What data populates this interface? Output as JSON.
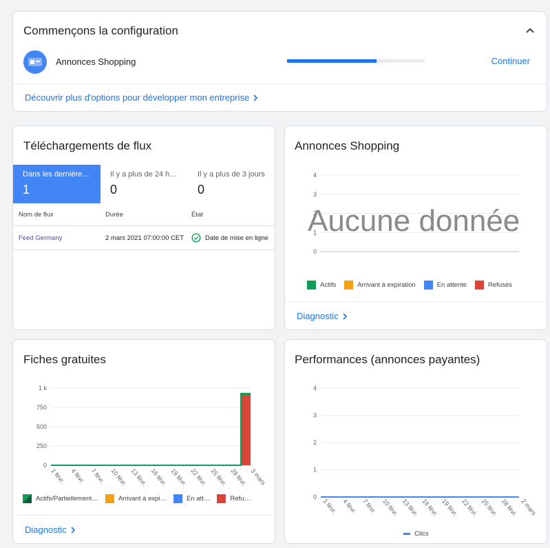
{
  "setup": {
    "title": "Commençons la configuration",
    "item_label": "Annonces Shopping",
    "progress": 0.65,
    "continue_label": "Continuer",
    "discover_label": "Découvrir plus d'options pour développer mon entreprise"
  },
  "feeds": {
    "title": "Téléchargements de flux",
    "tabs": [
      {
        "label": "Dans les dernières …",
        "value": "1"
      },
      {
        "label": "Il y a plus de 24 he…",
        "value": "0"
      },
      {
        "label": "Il y a plus de 3 jours",
        "value": "0"
      }
    ],
    "columns": [
      "Nom de flux",
      "Durée",
      "État"
    ],
    "rows": [
      {
        "name": "Feed Germany",
        "duration": "2 mars 2021 07:00:00 CET",
        "status": "Date de mise en ligne"
      }
    ]
  },
  "shopping": {
    "title": "Annonces Shopping",
    "no_data": "Aucune donnée",
    "diagnostic": "Diagnostic",
    "legend": [
      {
        "label": "Actifs",
        "color": "#0f9d58"
      },
      {
        "label": "Arrivant à expiration",
        "color": "#f4a010"
      },
      {
        "label": "En attente",
        "color": "#4285f4"
      },
      {
        "label": "Refusés",
        "color": "#db4437"
      }
    ]
  },
  "free": {
    "title": "Fiches gratuites",
    "diagnostic": "Diagnostic",
    "legend": [
      {
        "label": "Actifs/Partiellement…",
        "color": "#0f9d58"
      },
      {
        "label": "Arrivant à expi…",
        "color": "#f4a010"
      },
      {
        "label": "En att…",
        "color": "#4285f4"
      },
      {
        "label": "Refu…",
        "color": "#db4437"
      }
    ]
  },
  "perf": {
    "title": "Performances (annonces payantes)",
    "legend": [
      {
        "label": "Clics",
        "color": "#4285f4"
      }
    ]
  },
  "chart_data": [
    {
      "type": "bar",
      "title": "Annonces Shopping",
      "y_ticks": [
        "0",
        "1",
        "2",
        "3",
        "4"
      ],
      "ylim": [
        0,
        4
      ],
      "series": [],
      "annotation": "Aucune donnée",
      "grid": true,
      "legend_position": "bottom"
    },
    {
      "type": "area",
      "title": "Fiches gratuites",
      "x": [
        "1 févr.",
        "4 févr.",
        "7 févr.",
        "10 févr.",
        "13 févr.",
        "16 févr.",
        "19 févr.",
        "22 févr.",
        "25 févr.",
        "28 févr.",
        "3 mars"
      ],
      "y_ticks": [
        "0",
        "250",
        "500",
        "750",
        "1 k"
      ],
      "ylim": [
        0,
        1000
      ],
      "series": [
        {
          "name": "Actifs/Partiellement…",
          "values": [
            0,
            0,
            0,
            0,
            0,
            0,
            0,
            0,
            0,
            0,
            930
          ]
        },
        {
          "name": "Refu…",
          "values": [
            0,
            0,
            0,
            0,
            0,
            0,
            0,
            0,
            0,
            0,
            910
          ]
        }
      ],
      "grid": true,
      "legend_position": "bottom"
    },
    {
      "type": "line",
      "title": "Performances (annonces payantes)",
      "x": [
        "1 févr.",
        "4 févr.",
        "7 févr.",
        "10 févr.",
        "13 févr.",
        "16 févr.",
        "19 févr.",
        "22 févr.",
        "25 févr.",
        "28 févr.",
        "2 mars"
      ],
      "y_ticks": [
        "0",
        "1",
        "2",
        "3",
        "4"
      ],
      "ylim": [
        0,
        4
      ],
      "series": [
        {
          "name": "Clics",
          "values": [
            0,
            0,
            0,
            0,
            0,
            0,
            0,
            0,
            0,
            0,
            0
          ]
        }
      ],
      "grid": true,
      "legend_position": "bottom"
    }
  ]
}
